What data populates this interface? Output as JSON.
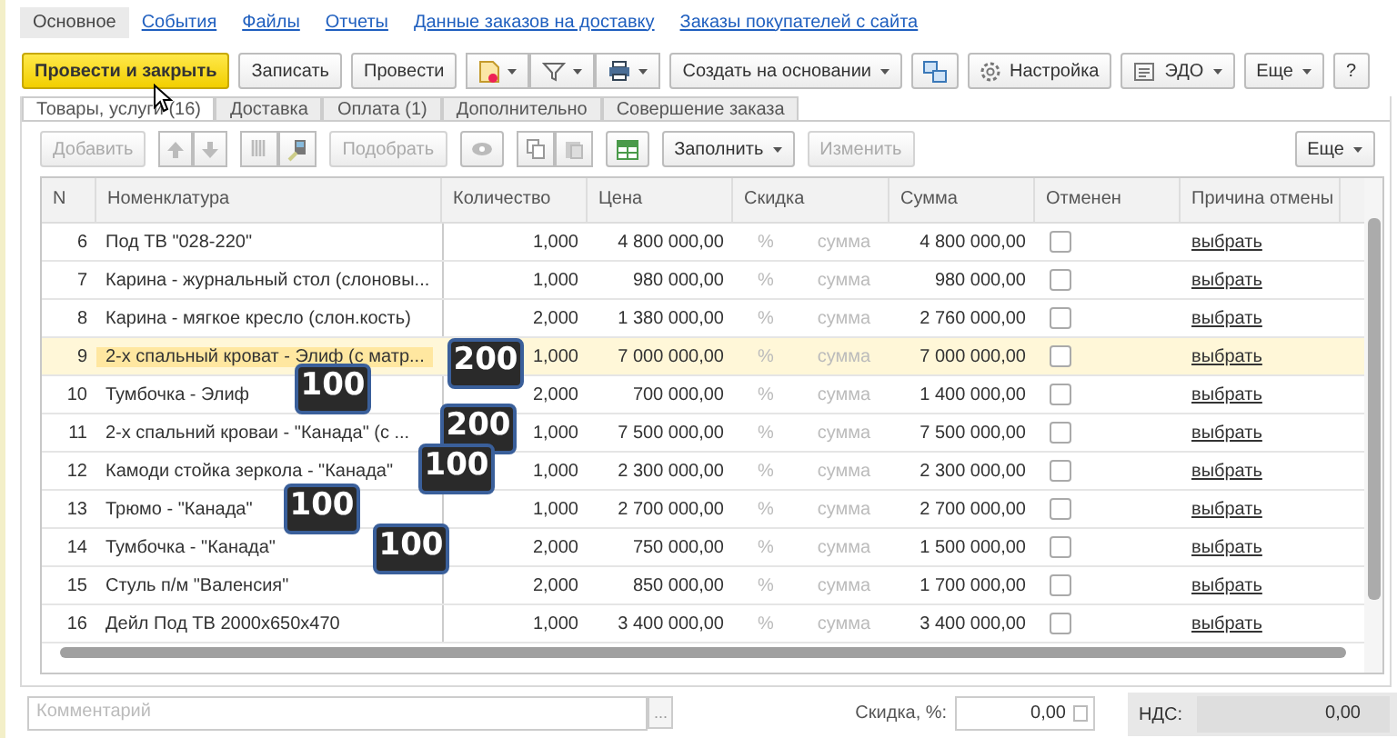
{
  "nav_tabs": [
    {
      "label": "Основное",
      "selected": true
    },
    {
      "label": "События",
      "selected": false
    },
    {
      "label": "Файлы",
      "selected": false
    },
    {
      "label": "Отчеты",
      "selected": false
    },
    {
      "label": "Данные заказов на доставку",
      "selected": false
    },
    {
      "label": "Заказы покупателей с сайта",
      "selected": false
    }
  ],
  "toolbar": [
    {
      "kind": "primary",
      "label": "Провести и закрыть"
    },
    {
      "kind": "button",
      "label": "Записать"
    },
    {
      "kind": "button",
      "label": "Провести"
    },
    {
      "kind": "icon-group"
    },
    {
      "kind": "menu",
      "label": "Создать на основании"
    },
    {
      "kind": "icon"
    },
    {
      "kind": "settings",
      "label": "Настройка"
    },
    {
      "kind": "edo",
      "label": "ЭДО"
    },
    {
      "kind": "menu",
      "label": "Еще"
    },
    {
      "kind": "button",
      "label": "?"
    }
  ],
  "doc_tabs": [
    {
      "label": "Товары, услуги (16)",
      "selected": true
    },
    {
      "label": "Доставка",
      "selected": false
    },
    {
      "label": "Оплата (1)",
      "selected": false
    },
    {
      "label": "Дополнительно",
      "selected": false
    },
    {
      "label": "Совершение заказа",
      "selected": false
    }
  ],
  "table_toolbar": [
    {
      "kind": "button",
      "label": "Добавить",
      "disabled": true
    },
    {
      "kind": "arrows"
    },
    {
      "kind": "scan"
    },
    {
      "kind": "button",
      "label": "Подобрать",
      "disabled": true
    },
    {
      "kind": "eye"
    },
    {
      "kind": "copy"
    },
    {
      "kind": "excel"
    },
    {
      "kind": "menu",
      "label": "Заполнить",
      "disabled": false
    },
    {
      "kind": "button",
      "label": "Изменить",
      "disabled": true
    },
    {
      "kind": "spacer"
    },
    {
      "kind": "menu",
      "label": "Еще",
      "disabled": false
    }
  ],
  "table": {
    "columns": [
      "N",
      "Номенклатура",
      "Количество",
      "Цена",
      "Скидка",
      "Сумма",
      "Отменен",
      "Причина отмены"
    ],
    "rows": [
      {
        "n": "6",
        "name": "Под ТВ \"028-220\"",
        "qty": "1,000",
        "price": "4 800 000,00",
        "discount_pct": "%",
        "discount_sum": "сумма",
        "sum": "4 800 000,00",
        "cancelled": false,
        "reason": "выбрать",
        "selected": false
      },
      {
        "n": "7",
        "name": "Карина - журнальный стол (слоновы...",
        "qty": "1,000",
        "price": "980 000,00",
        "discount_pct": "%",
        "discount_sum": "сумма",
        "sum": "980 000,00",
        "cancelled": false,
        "reason": "выбрать",
        "selected": false
      },
      {
        "n": "8",
        "name": "Карина - мягкое кресло (слон.кость)",
        "qty": "2,000",
        "price": "1 380 000,00",
        "discount_pct": "%",
        "discount_sum": "сумма",
        "sum": "2 760 000,00",
        "cancelled": false,
        "reason": "выбрать",
        "selected": false
      },
      {
        "n": "9",
        "name": "2-х спальный кроват  - Элиф (с матр...",
        "qty": "1,000",
        "price": "7 000 000,00",
        "discount_pct": "%",
        "discount_sum": "сумма",
        "sum": "7 000 000,00",
        "cancelled": false,
        "reason": "выбрать",
        "selected": true
      },
      {
        "n": "10",
        "name": "Тумбочка - Элиф",
        "qty": "2,000",
        "price": "700 000,00",
        "discount_pct": "%",
        "discount_sum": "сумма",
        "sum": "1 400 000,00",
        "cancelled": false,
        "reason": "выбрать",
        "selected": false
      },
      {
        "n": "11",
        "name": "2-х спальний кроваи  -  \"Канада\" (с ...",
        "qty": "1,000",
        "price": "7 500 000,00",
        "discount_pct": "%",
        "discount_sum": "сумма",
        "sum": "7 500 000,00",
        "cancelled": false,
        "reason": "выбрать",
        "selected": false
      },
      {
        "n": "12",
        "name": "Камоди стойка зеркола -  \"Канада\"",
        "qty": "1,000",
        "price": "2 300 000,00",
        "discount_pct": "%",
        "discount_sum": "сумма",
        "sum": "2 300 000,00",
        "cancelled": false,
        "reason": "выбрать",
        "selected": false
      },
      {
        "n": "13",
        "name": "Трюмо -  \"Канада\"",
        "qty": "1,000",
        "price": "2 700 000,00",
        "discount_pct": "%",
        "discount_sum": "сумма",
        "sum": "2 700 000,00",
        "cancelled": false,
        "reason": "выбрать",
        "selected": false
      },
      {
        "n": "14",
        "name": "Тумбочка -  \"Канада\"",
        "qty": "2,000",
        "price": "750 000,00",
        "discount_pct": "%",
        "discount_sum": "сумма",
        "sum": "1 500 000,00",
        "cancelled": false,
        "reason": "выбрать",
        "selected": false
      },
      {
        "n": "15",
        "name": "Стуль п/м \"Валенсия\"",
        "qty": "2,000",
        "price": "850 000,00",
        "discount_pct": "%",
        "discount_sum": "сумма",
        "sum": "1 700 000,00",
        "cancelled": false,
        "reason": "выбрать",
        "selected": false
      },
      {
        "n": "16",
        "name": "Дейл Под ТВ 2000x650x470",
        "qty": "1,000",
        "price": "3 400 000,00",
        "discount_pct": "%",
        "discount_sum": "сумма",
        "sum": "3 400 000,00",
        "cancelled": false,
        "reason": "выбрать",
        "selected": false
      }
    ]
  },
  "footer": {
    "comment_placeholder": "Комментарий",
    "more_button": "...",
    "discount_label": "Скидка, %:",
    "discount_value": "0,00",
    "vat_label": "НДС:",
    "vat_value": "0,00"
  },
  "badges": [
    "200",
    "100",
    "200",
    "100",
    "100",
    "100"
  ]
}
